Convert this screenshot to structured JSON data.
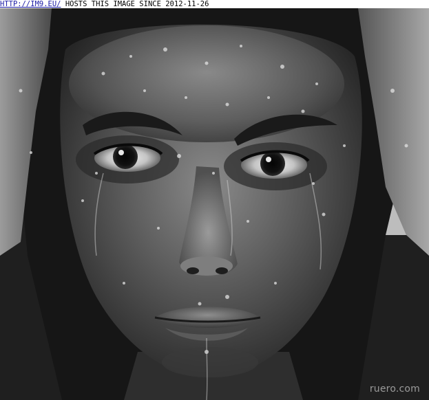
{
  "banner": {
    "link_text": "HTTP://IM9.EU/",
    "caption": "HOSTS THIS IMAGE SINCE 2012-11-26"
  },
  "photo": {
    "description": "Black and white close-up portrait of a woman with wet face and hands behind her head",
    "palette": {
      "background": "#1c1c1c",
      "skin_dark": "#3a3a3a",
      "skin_mid": "#6e6e6e",
      "skin_light": "#a8a8a8",
      "highlight": "#d8d8d8"
    }
  },
  "watermark": {
    "text": "ruero.com"
  }
}
